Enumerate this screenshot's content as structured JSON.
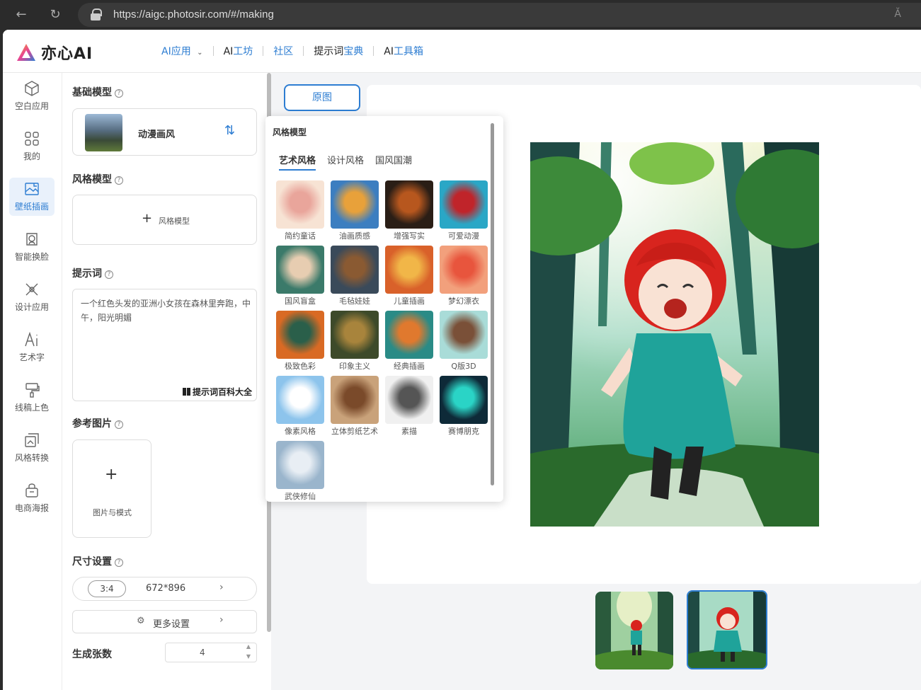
{
  "browser": {
    "url": "https://aigc.photosir.com/#/making",
    "reader_icon": "Ă"
  },
  "header": {
    "logo_text": "亦心AI",
    "nav": [
      {
        "a": "AI",
        "b": "应用",
        "dropdown": true
      },
      {
        "a": "AI",
        "b": "工坊"
      },
      {
        "a": "",
        "b": "社区"
      },
      {
        "a": "提示词",
        "b": "宝典"
      },
      {
        "a": "AI",
        "b": "工具箱"
      }
    ]
  },
  "sidebar": {
    "items": [
      {
        "label": "空白应用",
        "icon": "cube-icon"
      },
      {
        "label": "我的",
        "icon": "grid-icon"
      },
      {
        "label": "壁纸插画",
        "icon": "picture-icon",
        "active": true
      },
      {
        "label": "智能换脸",
        "icon": "face-icon"
      },
      {
        "label": "设计应用",
        "icon": "design-icon"
      },
      {
        "label": "艺术字",
        "icon": "ai-text-icon"
      },
      {
        "label": "线稿上色",
        "icon": "brush-icon"
      },
      {
        "label": "风格转换",
        "icon": "convert-icon"
      },
      {
        "label": "电商海报",
        "icon": "bag-icon"
      }
    ]
  },
  "panel": {
    "base_model_title": "基础模型",
    "base_model_name": "动漫画风",
    "style_model_title": "风格模型",
    "style_model_add": "风格模型",
    "prompt_title": "提示词",
    "prompt_text": "一个红色头发的亚洲小女孩在森林里奔跑，中午，阳光明媚",
    "prompt_library": "提示词百科大全",
    "ref_image_title": "参考图片",
    "ref_image_add": "图片与模式",
    "size_title": "尺寸设置",
    "ratio": "3:4",
    "dimensions": "672*896",
    "more_settings": "更多设置",
    "count_title": "生成张数",
    "count_value": "4"
  },
  "main": {
    "original_button": "原图"
  },
  "popup": {
    "title": "风格模型",
    "tabs": [
      "艺术风格",
      "设计风格",
      "国风国潮"
    ],
    "styles": [
      {
        "name": "简约童话",
        "colors": [
          "#f7e3d4",
          "#e9a59b"
        ]
      },
      {
        "name": "油画质感",
        "colors": [
          "#3c7ec0",
          "#e8a13a"
        ]
      },
      {
        "name": "增强写实",
        "colors": [
          "#2a1e16",
          "#b7571e"
        ]
      },
      {
        "name": "可爱动漫",
        "colors": [
          "#2aa7c6",
          "#c0242a"
        ]
      },
      {
        "name": "国风盲盒",
        "colors": [
          "#3b7a6a",
          "#e7cdb1"
        ]
      },
      {
        "name": "毛毡娃娃",
        "colors": [
          "#3a4a5a",
          "#8a5a32"
        ]
      },
      {
        "name": "儿童插画",
        "colors": [
          "#d9612a",
          "#f1b648"
        ]
      },
      {
        "name": "梦幻漂衣",
        "colors": [
          "#f2a07c",
          "#e8553d"
        ]
      },
      {
        "name": "极致色彩",
        "colors": [
          "#d96a24",
          "#2a5f4a"
        ]
      },
      {
        "name": "印象主义",
        "colors": [
          "#3d4a2a",
          "#a8843c"
        ]
      },
      {
        "name": "经典插画",
        "colors": [
          "#2a8b86",
          "#e0792e"
        ]
      },
      {
        "name": "Q版3D",
        "colors": [
          "#a9dcd8",
          "#7a5038"
        ]
      },
      {
        "name": "像素风格",
        "colors": [
          "#8dc4ec",
          "#ffffff"
        ]
      },
      {
        "name": "立体剪纸艺术",
        "colors": [
          "#c9a27a",
          "#7a4a2a"
        ]
      },
      {
        "name": "素描",
        "colors": [
          "#f0f0f0",
          "#555555"
        ]
      },
      {
        "name": "赛博朋克",
        "colors": [
          "#0e2a38",
          "#2ad4c6"
        ]
      },
      {
        "name": "武侠修仙",
        "colors": [
          "#9ab5cc",
          "#e8eef4"
        ]
      }
    ]
  }
}
